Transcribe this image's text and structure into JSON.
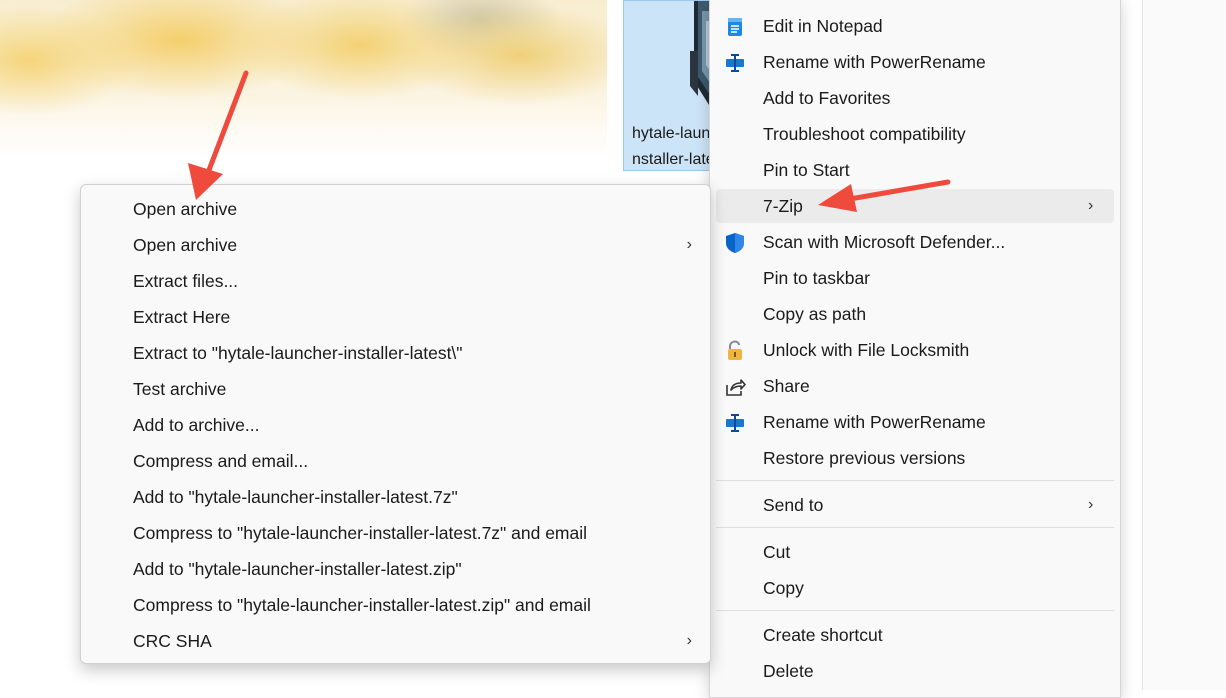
{
  "desktop": {
    "file_name_line1": "hytale-launcher-i",
    "file_name_line2": "nstaller-latest"
  },
  "context_menu": {
    "items": [
      {
        "label": "Edit in Notepad",
        "icon": "notepad-icon"
      },
      {
        "label": "Rename with PowerRename",
        "icon": "powerrename-icon"
      },
      {
        "label": "Add to Favorites",
        "icon": ""
      },
      {
        "label": "Troubleshoot compatibility",
        "icon": ""
      },
      {
        "label": "Pin to Start",
        "icon": ""
      },
      {
        "label": "7-Zip",
        "icon": "",
        "submenu": true,
        "highlighted": true
      },
      {
        "label": "Scan with Microsoft Defender...",
        "icon": "defender-shield-icon"
      },
      {
        "label": "Pin to taskbar",
        "icon": ""
      },
      {
        "label": "Copy as path",
        "icon": ""
      },
      {
        "label": "Unlock with File Locksmith",
        "icon": "lock-icon"
      },
      {
        "label": "Share",
        "icon": "share-icon"
      },
      {
        "label": "Rename with PowerRename",
        "icon": "powerrename-icon"
      },
      {
        "label": "Restore previous versions",
        "icon": ""
      },
      {
        "label": "Send to",
        "icon": "",
        "submenu": true
      },
      {
        "label": "Cut",
        "icon": ""
      },
      {
        "label": "Copy",
        "icon": ""
      },
      {
        "label": "Create shortcut",
        "icon": ""
      },
      {
        "label": "Delete",
        "icon": ""
      }
    ]
  },
  "sevenzip_menu": {
    "items": [
      {
        "label": "Open archive"
      },
      {
        "label": "Open archive",
        "submenu": true
      },
      {
        "label": "Extract files..."
      },
      {
        "label": "Extract Here"
      },
      {
        "label": "Extract to \"hytale-launcher-installer-latest\\\""
      },
      {
        "label": "Test archive"
      },
      {
        "label": "Add to archive..."
      },
      {
        "label": "Compress and email..."
      },
      {
        "label": "Add to \"hytale-launcher-installer-latest.7z\""
      },
      {
        "label": "Compress to \"hytale-launcher-installer-latest.7z\" and email"
      },
      {
        "label": "Add to \"hytale-launcher-installer-latest.zip\""
      },
      {
        "label": "Compress to \"hytale-launcher-installer-latest.zip\" and email"
      },
      {
        "label": "CRC SHA",
        "submenu": true
      }
    ]
  },
  "colors": {
    "annotation_arrow": "#ef4a3c",
    "menu_bg": "#f9f9f9",
    "selection_bg": "#cce4f7",
    "defender_blue": "#0a63c9"
  }
}
